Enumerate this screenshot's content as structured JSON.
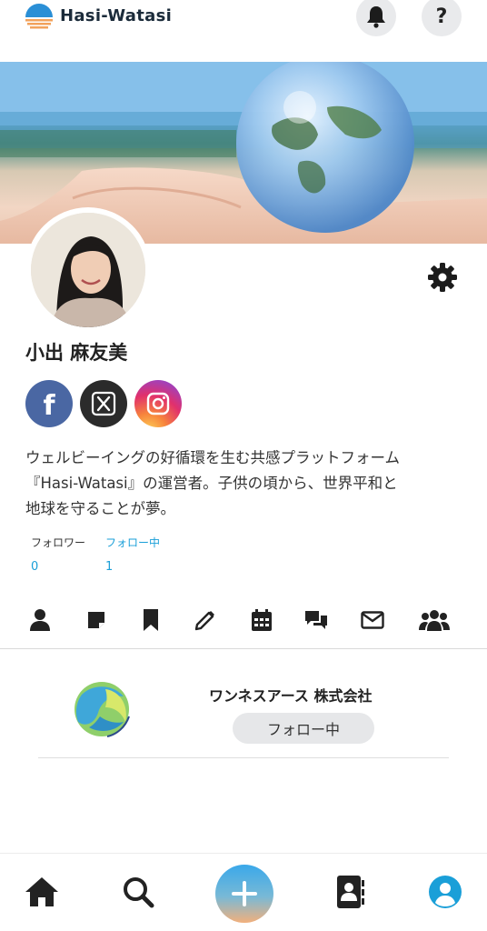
{
  "header": {
    "logo_text": "Hasi-Watasi",
    "help_label": "?"
  },
  "profile": {
    "name": "小出 麻友美",
    "bio_lines": [
      "ウェルビーイングの好循環を生む共感プラットフォーム",
      "『Hasi-Watasi』の運営者。子供の頃から、世界平和と",
      "地球を守ることが夢。"
    ],
    "stats": {
      "followers_label": "フォロワー",
      "followers_count": "0",
      "following_label": "フォロー中",
      "following_count": "1"
    }
  },
  "social": {
    "facebook_glyph": "f"
  },
  "following_list": [
    {
      "company": "ワンネスアース 株式会社",
      "button_label": "フォロー中"
    }
  ],
  "colors": {
    "accent_blue": "#1a9fd8",
    "facebook": "#4a67a3",
    "x_bg": "#2b2b2b",
    "nav_active": "#1a9fd8"
  },
  "icons": {
    "tabs": [
      "person-icon",
      "note-icon",
      "bookmark-icon",
      "pencil-icon",
      "calendar-icon",
      "chat-icon",
      "mail-icon",
      "group-icon"
    ],
    "bottom_nav": [
      "home-icon",
      "search-icon",
      "plus-icon",
      "contacts-icon",
      "account-icon"
    ]
  }
}
